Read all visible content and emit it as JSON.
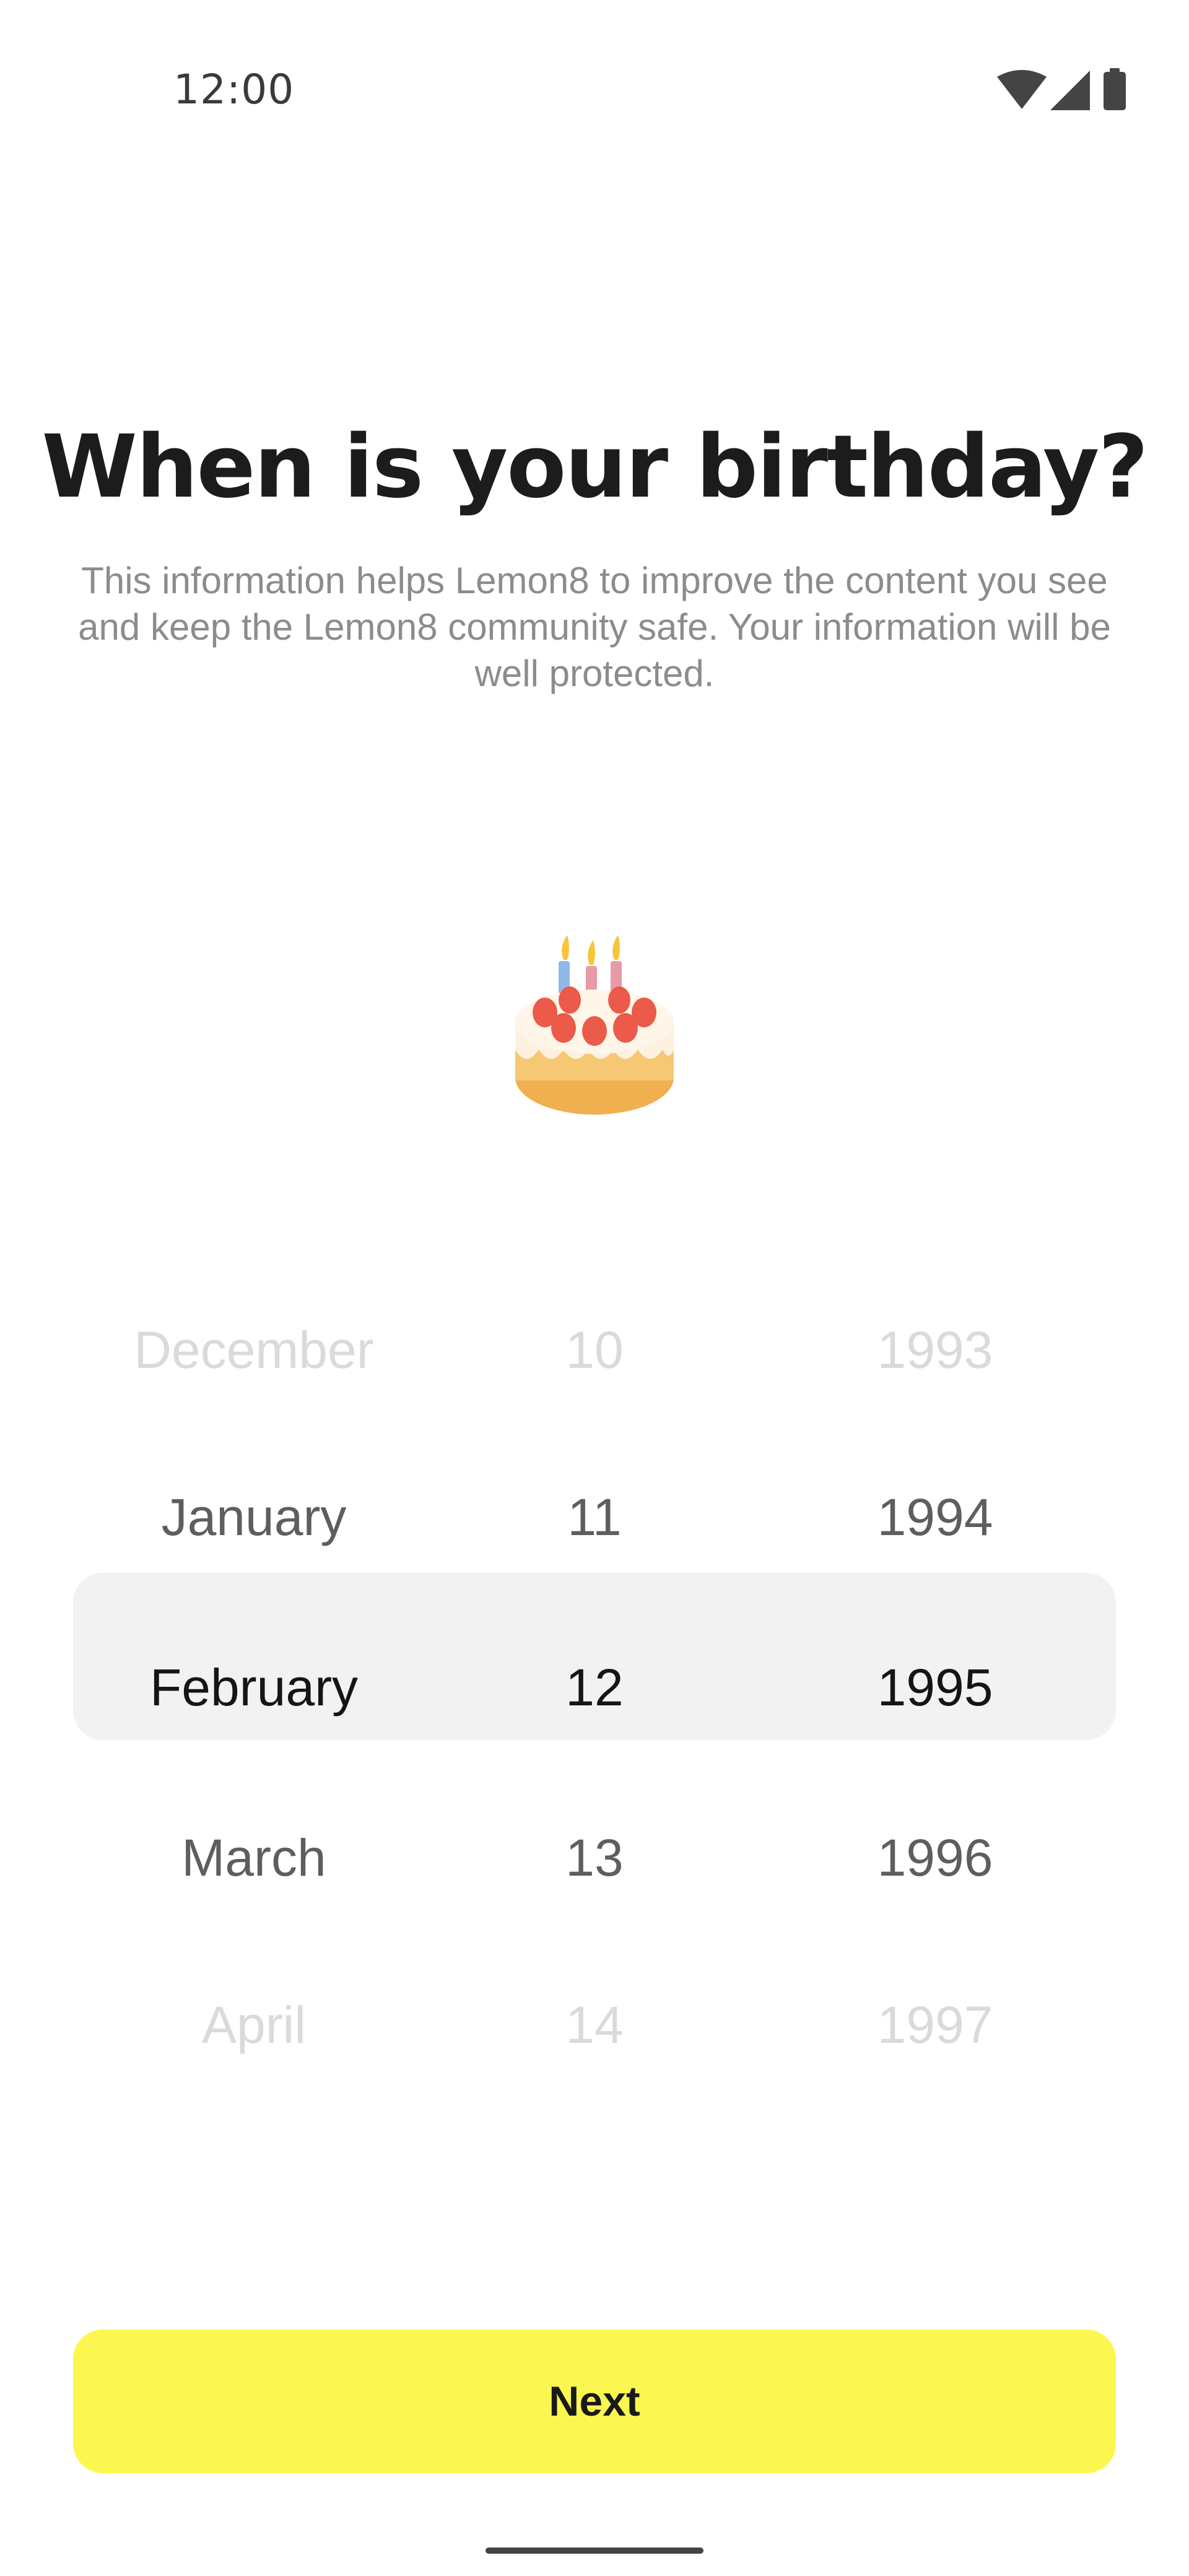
{
  "status_bar": {
    "time": "12:00",
    "icons": [
      "wifi-icon",
      "cellular-signal-icon",
      "battery-icon"
    ]
  },
  "header": {
    "title": "When is your birthday?",
    "subtitle": "This information helps Lemon8 to improve the content you see and keep the Lemon8 community safe. Your information will be well protected."
  },
  "illustration": {
    "icon": "birthday-cake-icon"
  },
  "picker": {
    "months": [
      "December",
      "January",
      "February",
      "March",
      "April"
    ],
    "days": [
      "10",
      "11",
      "12",
      "13",
      "14"
    ],
    "years": [
      "1993",
      "1994",
      "1995",
      "1996",
      "1997"
    ],
    "selected": {
      "month": "February",
      "day": "12",
      "year": "1995"
    }
  },
  "actions": {
    "next_label": "Next"
  },
  "colors": {
    "accent": "#fcf750",
    "selection_background": "#f2f2f2",
    "subtitle_text": "#8c8c8c"
  }
}
